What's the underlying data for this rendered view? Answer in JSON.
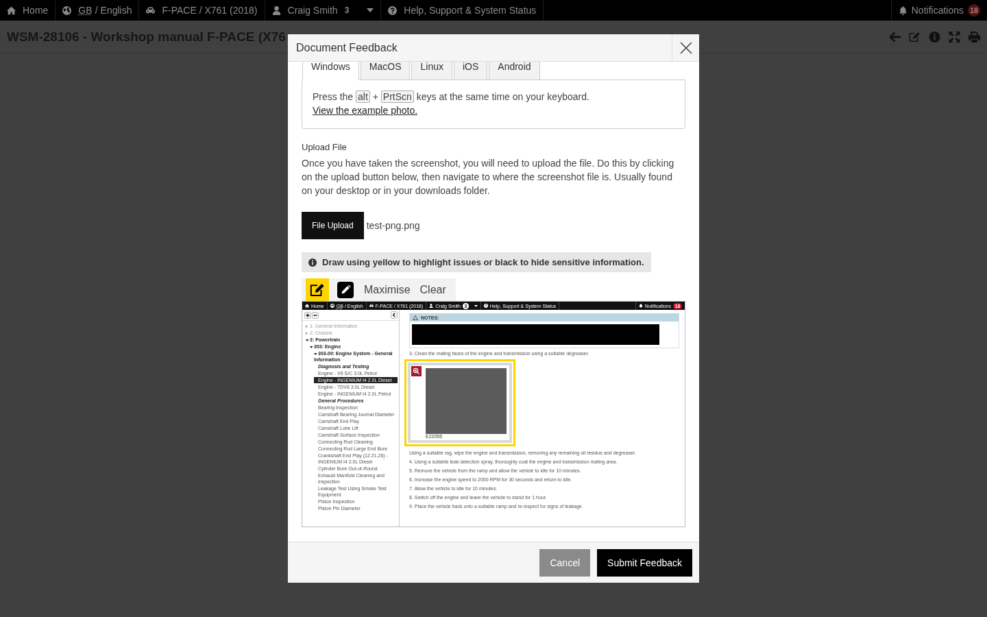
{
  "top_nav": {
    "items": [
      {
        "kind": "home",
        "label": "Home"
      },
      {
        "kind": "language",
        "abbr": "GB",
        "label": "/ English"
      },
      {
        "kind": "vehicle",
        "label": "F-PACE / X761 (2018)"
      },
      {
        "kind": "user",
        "label": "Craig Smith",
        "badge": "3"
      },
      {
        "kind": "help",
        "label": "Help, Support & System Status"
      }
    ],
    "notifications": {
      "label": "Notifications",
      "badge": "18"
    }
  },
  "page_header": {
    "title": "WSM-28106 - Workshop manual F-PACE (X76"
  },
  "feedback_modal": {
    "title": "Document Feedback",
    "os_tabs": [
      {
        "label": "Windows",
        "selected": true
      },
      {
        "label": "MacOS",
        "selected": false
      },
      {
        "label": "Linux",
        "selected": false
      },
      {
        "label": "iOS",
        "selected": false
      },
      {
        "label": "Android",
        "selected": false
      }
    ],
    "instructions": {
      "before": "Press the",
      "keys": [
        "alt",
        "PrtScn"
      ],
      "joiner": "+",
      "after": "keys at the same time on your keyboard.",
      "link": "View the example photo."
    },
    "upload": {
      "heading": "Upload File",
      "text": "Once you have taken the screenshot, you will need to upload the file. Do this by clicking on the upload button below, then navigate to where the screenshot file is. Usually found on your desktop or in your downloads folder.",
      "button": "File Upload",
      "file_name": "test-png.png"
    },
    "hint": "Draw using yellow to highlight issues or black to hide sensitive information.",
    "drawing_tools": [
      {
        "kind": "highlight",
        "color": "#ffd400",
        "selected": true
      },
      {
        "kind": "hide",
        "color": "#000000",
        "selected": false
      }
    ],
    "tool_actions": [
      "Maximise",
      "Clear"
    ],
    "screenshot": {
      "top_nav": {
        "items": [
          {
            "kind": "home",
            "label": "Home"
          },
          {
            "kind": "language",
            "abbr": "GB",
            "label": "/ English"
          },
          {
            "kind": "vehicle",
            "label": "F-PACE / X761 (2018)"
          },
          {
            "kind": "user",
            "label": "Craig Smith",
            "badge": "3"
          },
          {
            "kind": "help",
            "label": "Help, Support & System Status"
          }
        ],
        "notifications": {
          "label": "Notifications",
          "badge": "18"
        }
      },
      "sidebar": {
        "tree": [
          {
            "kind": "group",
            "label": "1: General Information",
            "expanded": false
          },
          {
            "kind": "group",
            "label": "2: Chassis",
            "expanded": false
          },
          {
            "kind": "group",
            "label": "3: Powertrain",
            "expanded": true,
            "children": [
              {
                "kind": "group",
                "label": "303: Engine",
                "expanded": true,
                "children": [
                  {
                    "kind": "group",
                    "label": "303-00: Engine System - General Information",
                    "expanded": true,
                    "children": [
                      {
                        "kind": "heading",
                        "label": "Diagnosis and Testing"
                      },
                      {
                        "kind": "link",
                        "label": "Engine - V6 S/C 3.0L Petrol",
                        "selected": false
                      },
                      {
                        "kind": "link",
                        "label": "Engine - INGENIUM I4 2.0L Diesel",
                        "selected": true
                      },
                      {
                        "kind": "link",
                        "label": "Engine - TDV6 3.0L Diesel",
                        "selected": false
                      },
                      {
                        "kind": "link",
                        "label": "Engine - INGENIUM I4 2.0L Petrol",
                        "selected": false
                      },
                      {
                        "kind": "heading",
                        "label": "General Procedures"
                      },
                      {
                        "kind": "link",
                        "label": "Bearing Inspection",
                        "selected": false
                      },
                      {
                        "kind": "link",
                        "label": "Camshaft Bearing Journal Diameter",
                        "selected": false
                      },
                      {
                        "kind": "link",
                        "label": "Camshaft End Play",
                        "selected": false
                      },
                      {
                        "kind": "link",
                        "label": "Camshaft Lobe Lift",
                        "selected": false
                      },
                      {
                        "kind": "link",
                        "label": "Camshaft Surface Inspection",
                        "selected": false
                      },
                      {
                        "kind": "link",
                        "label": "Connecting Rod Cleaning",
                        "selected": false
                      },
                      {
                        "kind": "link",
                        "label": "Connecting Rod Large End Bore",
                        "selected": false
                      },
                      {
                        "kind": "link",
                        "label": "Crankshaft End Play (12.21.26) - INGENIUM I4 2.0L Diesel",
                        "selected": false
                      },
                      {
                        "kind": "link",
                        "label": "Cylinder Bore Out-of-Round",
                        "selected": false
                      },
                      {
                        "kind": "link",
                        "label": "Exhaust Manifold Cleaning and Inspection",
                        "selected": false
                      },
                      {
                        "kind": "link",
                        "label": "Leakage Test Using Smoke Test Equipment",
                        "selected": false
                      },
                      {
                        "kind": "link",
                        "label": "Piston Inspection",
                        "selected": false
                      },
                      {
                        "kind": "link",
                        "label": "Piston Pin Diameter",
                        "selected": false
                      }
                    ]
                  }
                ]
              }
            ]
          }
        ]
      },
      "content": [
        {
          "kind": "notes",
          "label": "NOTES:",
          "redacted": true
        },
        {
          "kind": "step",
          "text": "3. Clean the mating faces of the engine and transmission using a suitable degreaser."
        },
        {
          "kind": "figure",
          "caption": "E22055",
          "highlighted": true
        },
        {
          "kind": "step",
          "text": "Using a suitable rag, wipe the engine and transmission, removing any remaining oil residue and degreaser."
        },
        {
          "kind": "step",
          "text": "4. Using a suitable leak detection spray, thoroughly coat the engine and transmission mating area."
        },
        {
          "kind": "step",
          "text": "5. Remove the vehicle from the ramp and allow the vehicle to idle for 10 minutes."
        },
        {
          "kind": "step",
          "text": "6. Increase the engine speed to 2000 RPM for 30 seconds and return to idle."
        },
        {
          "kind": "step",
          "text": "7. Allow the vehicle to idle for 10 minutes."
        },
        {
          "kind": "step",
          "text": "8. Switch off the engine and leave the vehicle to stand for 1 hour."
        },
        {
          "kind": "step",
          "text": "9. Place the vehicle back onto a suitable ramp and re-inspect for signs of leakage."
        }
      ]
    },
    "buttons": [
      {
        "kind": "secondary",
        "label": "Cancel"
      },
      {
        "kind": "primary",
        "label": "Submit Feedback"
      }
    ]
  }
}
